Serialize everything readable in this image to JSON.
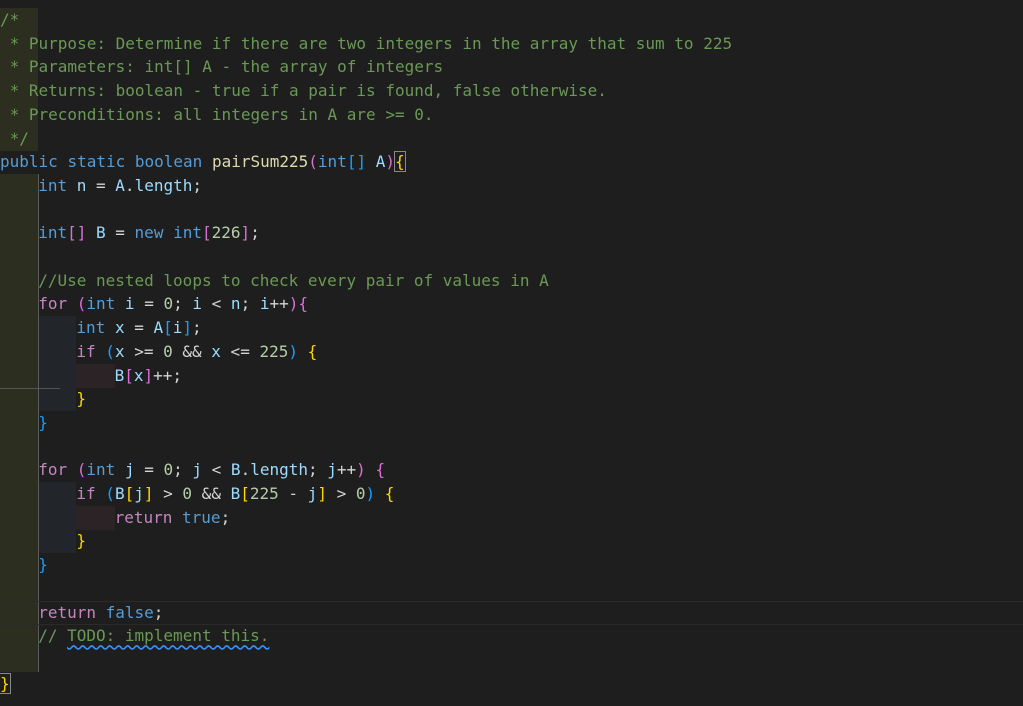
{
  "editor": {
    "language": "Java",
    "lines": [
      {
        "indent": 0,
        "tokens": [
          [
            "cm",
            "/*"
          ]
        ]
      },
      {
        "indent": 0,
        "tokens": [
          [
            "cm",
            " * Purpose: Determine if there are two integers in the array that sum to 225"
          ]
        ]
      },
      {
        "indent": 0,
        "tokens": [
          [
            "cm",
            " * Parameters: int[] A - the array of integers"
          ]
        ]
      },
      {
        "indent": 0,
        "tokens": [
          [
            "cm",
            " * Returns: boolean - true if a pair is found, false otherwise."
          ]
        ]
      },
      {
        "indent": 0,
        "tokens": [
          [
            "cm",
            " * Preconditions: all integers in A are >= 0."
          ]
        ]
      },
      {
        "indent": 0,
        "tokens": [
          [
            "cm",
            " */"
          ]
        ]
      },
      {
        "indent": 0,
        "tokens": [
          [
            "kw",
            "public"
          ],
          [
            "op",
            " "
          ],
          [
            "kw",
            "static"
          ],
          [
            "op",
            " "
          ],
          [
            "kw",
            "boolean"
          ],
          [
            "op",
            " "
          ],
          [
            "fn",
            "pairSum225"
          ],
          [
            "p2",
            "("
          ],
          [
            "kw",
            "int"
          ],
          [
            "p3",
            "[]"
          ],
          [
            "op",
            " "
          ],
          [
            "var",
            "A"
          ],
          [
            "p2",
            ")"
          ],
          [
            "p1b",
            "{"
          ]
        ]
      },
      {
        "indent": 1,
        "tokens": [
          [
            "kw",
            "int"
          ],
          [
            "op",
            " "
          ],
          [
            "var",
            "n"
          ],
          [
            "op",
            " = "
          ],
          [
            "var",
            "A"
          ],
          [
            "op",
            "."
          ],
          [
            "var",
            "length"
          ],
          [
            "op",
            ";"
          ]
        ]
      },
      {
        "indent": 0,
        "tokens": []
      },
      {
        "indent": 1,
        "tokens": [
          [
            "kw",
            "int"
          ],
          [
            "p2",
            "[]"
          ],
          [
            "op",
            " "
          ],
          [
            "var",
            "B"
          ],
          [
            "op",
            " = "
          ],
          [
            "kw",
            "new"
          ],
          [
            "op",
            " "
          ],
          [
            "kw",
            "int"
          ],
          [
            "p2",
            "["
          ],
          [
            "num",
            "226"
          ],
          [
            "p2",
            "]"
          ],
          [
            "op",
            ";"
          ]
        ]
      },
      {
        "indent": 0,
        "tokens": []
      },
      {
        "indent": 1,
        "tokens": [
          [
            "cm",
            "//Use nested loops to check every pair of values in A"
          ]
        ]
      },
      {
        "indent": 1,
        "tokens": [
          [
            "ctl",
            "for"
          ],
          [
            "op",
            " "
          ],
          [
            "p2",
            "("
          ],
          [
            "kw",
            "int"
          ],
          [
            "op",
            " "
          ],
          [
            "var",
            "i"
          ],
          [
            "op",
            " = "
          ],
          [
            "num",
            "0"
          ],
          [
            "op",
            "; "
          ],
          [
            "var",
            "i"
          ],
          [
            "op",
            " < "
          ],
          [
            "var",
            "n"
          ],
          [
            "op",
            "; "
          ],
          [
            "var",
            "i"
          ],
          [
            "op",
            "++"
          ],
          [
            "p2",
            ")"
          ],
          [
            "p2",
            "{"
          ]
        ]
      },
      {
        "indent": 2,
        "tokens": [
          [
            "kw",
            "int"
          ],
          [
            "op",
            " "
          ],
          [
            "var",
            "x"
          ],
          [
            "op",
            " = "
          ],
          [
            "var",
            "A"
          ],
          [
            "p3",
            "["
          ],
          [
            "var",
            "i"
          ],
          [
            "p3",
            "]"
          ],
          [
            "op",
            ";"
          ]
        ]
      },
      {
        "indent": 2,
        "tokens": [
          [
            "ctl",
            "if"
          ],
          [
            "op",
            " "
          ],
          [
            "p3",
            "("
          ],
          [
            "var",
            "x"
          ],
          [
            "op",
            " >= "
          ],
          [
            "num",
            "0"
          ],
          [
            "op",
            " && "
          ],
          [
            "var",
            "x"
          ],
          [
            "op",
            " <= "
          ],
          [
            "num",
            "225"
          ],
          [
            "p3",
            ")"
          ],
          [
            "op",
            " "
          ],
          [
            "p1",
            "{"
          ]
        ]
      },
      {
        "indent": 3,
        "tokens": [
          [
            "var",
            "B"
          ],
          [
            "p2",
            "["
          ],
          [
            "var",
            "x"
          ],
          [
            "p2",
            "]"
          ],
          [
            "op",
            "++;"
          ]
        ]
      },
      {
        "indent": 2,
        "tokens": [
          [
            "p1",
            "}"
          ]
        ]
      },
      {
        "indent": 1,
        "tokens": [
          [
            "p3",
            "}"
          ]
        ]
      },
      {
        "indent": 0,
        "tokens": []
      },
      {
        "indent": 1,
        "tokens": [
          [
            "ctl",
            "for"
          ],
          [
            "op",
            " "
          ],
          [
            "p2",
            "("
          ],
          [
            "kw",
            "int"
          ],
          [
            "op",
            " "
          ],
          [
            "var",
            "j"
          ],
          [
            "op",
            " = "
          ],
          [
            "num",
            "0"
          ],
          [
            "op",
            "; "
          ],
          [
            "var",
            "j"
          ],
          [
            "op",
            " < "
          ],
          [
            "var",
            "B"
          ],
          [
            "op",
            "."
          ],
          [
            "var",
            "length"
          ],
          [
            "op",
            "; "
          ],
          [
            "var",
            "j"
          ],
          [
            "op",
            "++"
          ],
          [
            "p2",
            ")"
          ],
          [
            "op",
            " "
          ],
          [
            "p2",
            "{"
          ]
        ]
      },
      {
        "indent": 2,
        "tokens": [
          [
            "ctl",
            "if"
          ],
          [
            "op",
            " "
          ],
          [
            "p3",
            "("
          ],
          [
            "var",
            "B"
          ],
          [
            "p1",
            "["
          ],
          [
            "var",
            "j"
          ],
          [
            "p1",
            "]"
          ],
          [
            "op",
            " > "
          ],
          [
            "num",
            "0"
          ],
          [
            "op",
            " && "
          ],
          [
            "var",
            "B"
          ],
          [
            "p1",
            "["
          ],
          [
            "num",
            "225"
          ],
          [
            "op",
            " - "
          ],
          [
            "var",
            "j"
          ],
          [
            "p1",
            "]"
          ],
          [
            "op",
            " > "
          ],
          [
            "num",
            "0"
          ],
          [
            "p3",
            ")"
          ],
          [
            "op",
            " "
          ],
          [
            "p1",
            "{"
          ]
        ]
      },
      {
        "indent": 3,
        "tokens": [
          [
            "ctl",
            "return"
          ],
          [
            "op",
            " "
          ],
          [
            "kw",
            "true"
          ],
          [
            "op",
            ";"
          ]
        ]
      },
      {
        "indent": 2,
        "tokens": [
          [
            "p1",
            "}"
          ]
        ]
      },
      {
        "indent": 1,
        "tokens": [
          [
            "p3",
            "}"
          ]
        ]
      },
      {
        "indent": 0,
        "tokens": []
      },
      {
        "indent": 1,
        "tokens": [
          [
            "ctl",
            "return"
          ],
          [
            "op",
            " "
          ],
          [
            "kw",
            "false"
          ],
          [
            "op",
            ";"
          ]
        ]
      },
      {
        "indent": 1,
        "tokens": [
          [
            "cm",
            "// "
          ],
          [
            "cmsq",
            "TODO: implement this."
          ]
        ]
      },
      {
        "indent": 1,
        "tokens": []
      },
      {
        "indent": 0,
        "tokens": [
          [
            "p1b",
            "}"
          ]
        ]
      }
    ]
  },
  "colors": {
    "background": "#1e1e1e",
    "comment": "#6a9955",
    "keyword": "#569cd6",
    "control": "#c586c0",
    "function": "#dcdcaa",
    "variable": "#9cdcfe",
    "number": "#b5cea8"
  }
}
